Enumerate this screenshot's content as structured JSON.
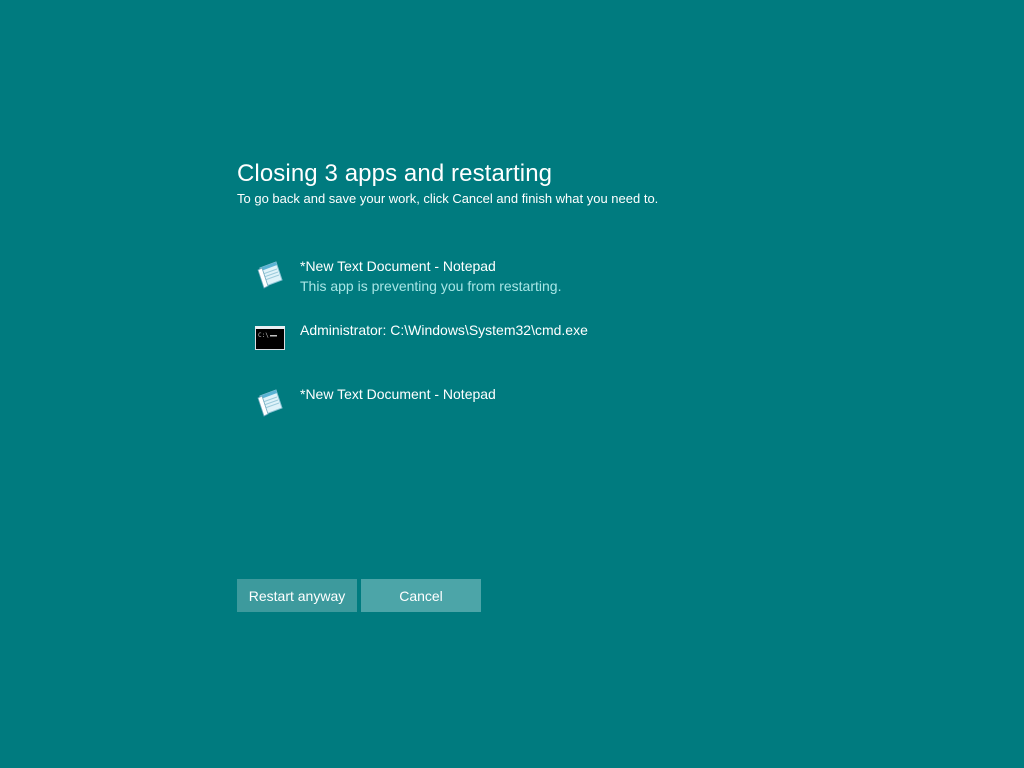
{
  "header": {
    "title": "Closing 3 apps and restarting",
    "subtitle": "To go back and save your work, click Cancel and finish what you need to."
  },
  "apps": [
    {
      "name": "*New Text Document - Notepad",
      "status": "This app is preventing you from restarting.",
      "icon": "notepad-icon"
    },
    {
      "name": "Administrator: C:\\Windows\\System32\\cmd.exe",
      "status": "",
      "icon": "cmd-icon"
    },
    {
      "name": "*New Text Document - Notepad",
      "status": "",
      "icon": "notepad-icon"
    }
  ],
  "buttons": {
    "restart_label": "Restart anyway",
    "cancel_label": "Cancel"
  },
  "colors": {
    "background": "#007b7f",
    "status_text": "#a8e6e6",
    "button_restart": "#3d9a9d",
    "button_cancel": "#4ca5a8"
  }
}
